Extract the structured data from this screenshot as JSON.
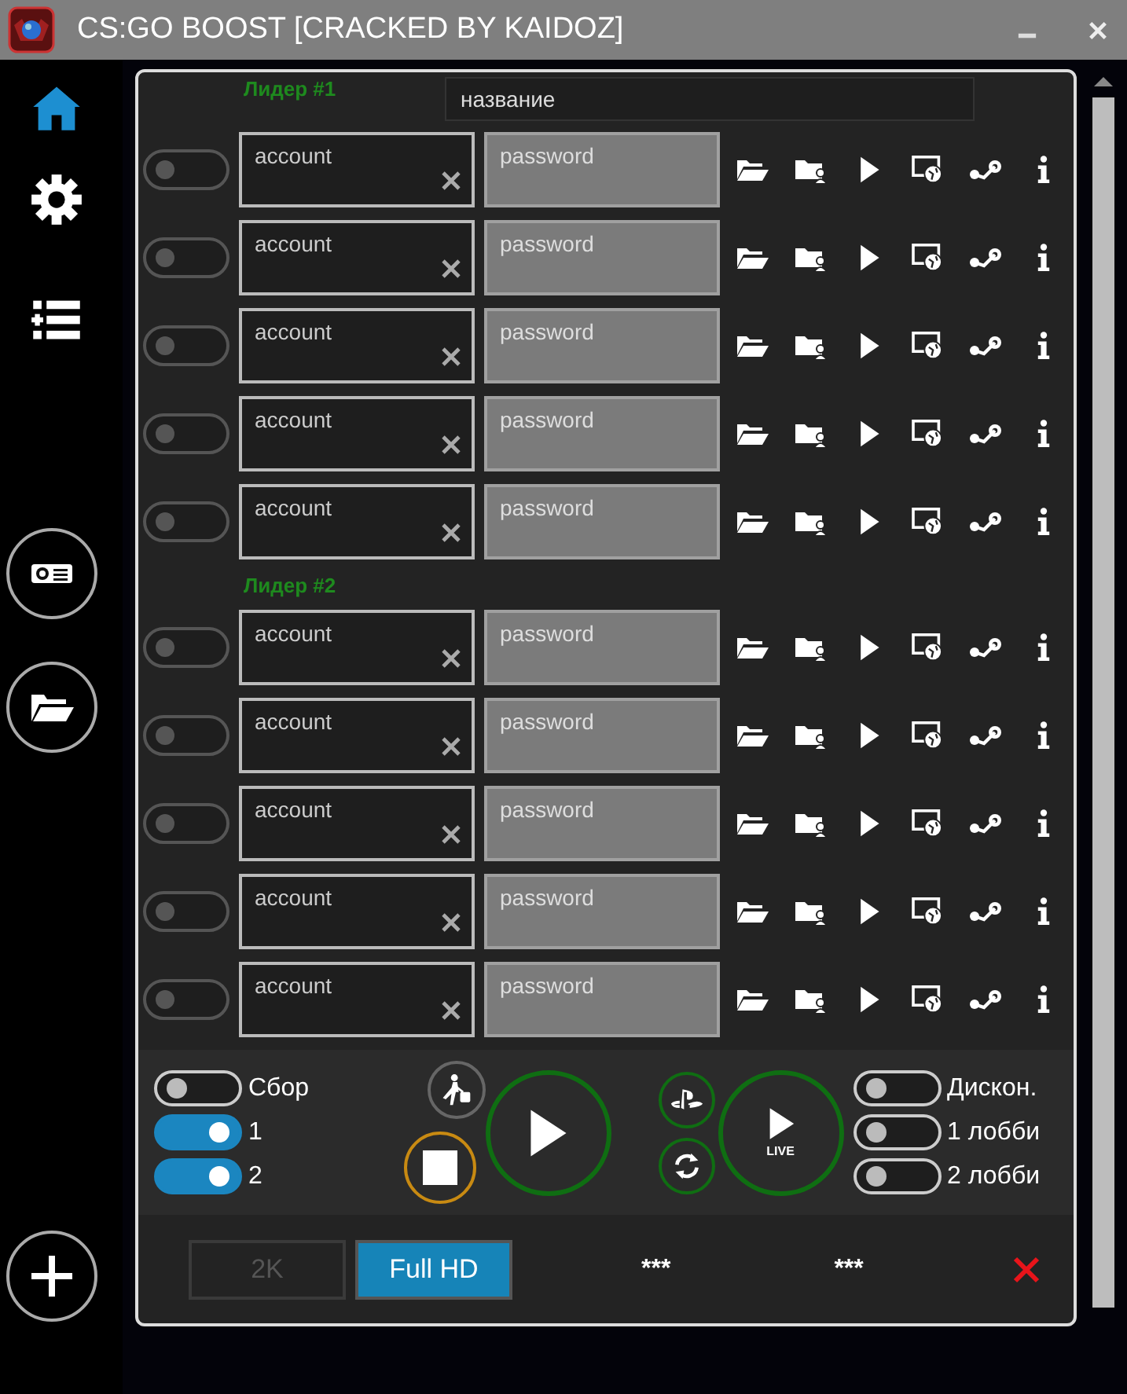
{
  "window": {
    "title": "CS:GO BOOST [CRACKED BY KAIDOZ]"
  },
  "sidebar": {
    "items": [
      {
        "kind": "home",
        "selected": true
      },
      {
        "kind": "settings",
        "selected": false
      },
      {
        "kind": "list",
        "selected": false
      }
    ],
    "round_buttons": [
      {
        "kind": "projector"
      },
      {
        "kind": "folder"
      }
    ]
  },
  "name_field": {
    "placeholder": "название"
  },
  "groups": [
    {
      "label": "Лидер #1",
      "rows": [
        {
          "on": false,
          "account": {
            "placeholder": "account"
          },
          "password": {
            "placeholder": "password"
          }
        },
        {
          "on": false,
          "account": {
            "placeholder": "account"
          },
          "password": {
            "placeholder": "password"
          }
        },
        {
          "on": false,
          "account": {
            "placeholder": "account"
          },
          "password": {
            "placeholder": "password"
          }
        },
        {
          "on": false,
          "account": {
            "placeholder": "account"
          },
          "password": {
            "placeholder": "password"
          }
        },
        {
          "on": false,
          "account": {
            "placeholder": "account"
          },
          "password": {
            "placeholder": "password"
          }
        }
      ]
    },
    {
      "label": "Лидер #2",
      "rows": [
        {
          "on": false,
          "account": {
            "placeholder": "account"
          },
          "password": {
            "placeholder": "password"
          }
        },
        {
          "on": false,
          "account": {
            "placeholder": "account"
          },
          "password": {
            "placeholder": "password"
          }
        },
        {
          "on": false,
          "account": {
            "placeholder": "account"
          },
          "password": {
            "placeholder": "password"
          }
        },
        {
          "on": false,
          "account": {
            "placeholder": "account"
          },
          "password": {
            "placeholder": "password"
          }
        },
        {
          "on": false,
          "account": {
            "placeholder": "account"
          },
          "password": {
            "placeholder": "password"
          }
        }
      ]
    }
  ],
  "controls": {
    "toggles_left": [
      {
        "label": "Сбор",
        "on": false
      },
      {
        "label": "1",
        "on": true
      },
      {
        "label": "2",
        "on": true
      }
    ],
    "live_label": "LIVE",
    "toggles_right": [
      {
        "label": "Дискон.",
        "on": false
      },
      {
        "label": "1 лобби",
        "on": false
      },
      {
        "label": "2 лобби",
        "on": false
      }
    ]
  },
  "footer": {
    "resolutions": [
      {
        "label": "2K",
        "selected": false
      },
      {
        "label": "Full HD",
        "selected": true
      }
    ],
    "counters": [
      "***",
      "***"
    ]
  }
}
